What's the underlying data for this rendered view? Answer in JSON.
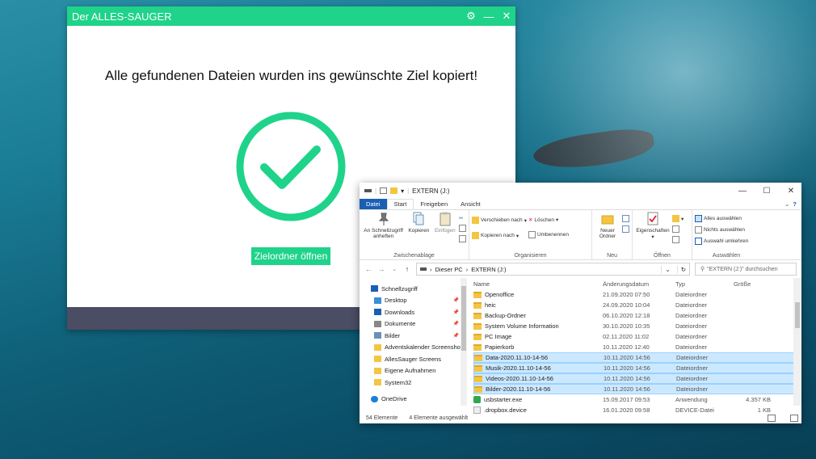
{
  "sauger": {
    "title": "Der ALLES-SAUGER",
    "message": "Alle gefundenen Dateien wurden ins gewünschte Ziel kopiert!",
    "button": "Zielordner öffnen",
    "accent": "#1fd38a"
  },
  "explorer": {
    "title": "EXTERN (J:)",
    "tabs": [
      "Datei",
      "Start",
      "Freigeben",
      "Ansicht"
    ],
    "ribbon": {
      "clipboard": {
        "label": "Zwischenablage",
        "pin": "An Schnellzugriff anheften",
        "copy": "Kopieren",
        "paste": "Einfügen"
      },
      "organize": {
        "label": "Organisieren",
        "move": "Verschieben nach",
        "copy_to": "Kopieren nach",
        "delete": "Löschen",
        "rename": "Umbenennen"
      },
      "new": {
        "label": "Neu",
        "folder": "Neuer Ordner"
      },
      "open": {
        "label": "Öffnen",
        "properties": "Eigenschaften"
      },
      "select": {
        "label": "Auswählen",
        "all": "Alles auswählen",
        "none": "Nichts auswählen",
        "invert": "Auswahl umkehren"
      }
    },
    "address": {
      "pc": "Dieser PC",
      "drive": "EXTERN (J:)",
      "search_placeholder": "\"EXTERN (J:)\" durchsuchen"
    },
    "nav": [
      {
        "label": "Schnellzugriff",
        "icon": "star-icon",
        "pinned": false
      },
      {
        "label": "Desktop",
        "icon": "desktop-icon",
        "pinned": true
      },
      {
        "label": "Downloads",
        "icon": "download-icon",
        "pinned": true
      },
      {
        "label": "Dokumente",
        "icon": "document-icon",
        "pinned": true
      },
      {
        "label": "Bilder",
        "icon": "picture-icon",
        "pinned": true
      },
      {
        "label": "Adventskalender Screensho",
        "icon": "folder-icon",
        "pinned": false
      },
      {
        "label": "AllesSauger Screens",
        "icon": "folder-icon",
        "pinned": false
      },
      {
        "label": "Eigene Aufnahmen",
        "icon": "folder-icon",
        "pinned": false
      },
      {
        "label": "System32",
        "icon": "folder-icon",
        "pinned": false
      },
      {
        "label": "OneDrive",
        "icon": "cloud-icon",
        "pinned": false
      }
    ],
    "pin_glyph": "📌",
    "columns": {
      "name": "Name",
      "date": "Änderungsdatum",
      "type": "Typ",
      "size": "Größe"
    },
    "rows": [
      {
        "name": "Openoffice",
        "date": "21.09.2020 07:50",
        "type": "Dateiordner",
        "size": "",
        "kind": "folder",
        "selected": false
      },
      {
        "name": "heic",
        "date": "24.09.2020 10:04",
        "type": "Dateiordner",
        "size": "",
        "kind": "folder",
        "selected": false
      },
      {
        "name": "Backup-Ordner",
        "date": "06.10.2020 12:18",
        "type": "Dateiordner",
        "size": "",
        "kind": "folder",
        "selected": false
      },
      {
        "name": "System Volume Information",
        "date": "30.10.2020 10:35",
        "type": "Dateiordner",
        "size": "",
        "kind": "folder",
        "selected": false
      },
      {
        "name": "PC Image",
        "date": "02.11.2020 11:02",
        "type": "Dateiordner",
        "size": "",
        "kind": "folder",
        "selected": false
      },
      {
        "name": "Papierkorb",
        "date": "10.11.2020 12:40",
        "type": "Dateiordner",
        "size": "",
        "kind": "folder",
        "selected": false
      },
      {
        "name": "Data-2020.11.10-14-56",
        "date": "10.11.2020 14:56",
        "type": "Dateiordner",
        "size": "",
        "kind": "folder",
        "selected": true
      },
      {
        "name": "Musik-2020.11.10-14-56",
        "date": "10.11.2020 14:56",
        "type": "Dateiordner",
        "size": "",
        "kind": "folder",
        "selected": true
      },
      {
        "name": "Videos-2020.11.10-14-56",
        "date": "10.11.2020 14:56",
        "type": "Dateiordner",
        "size": "",
        "kind": "folder",
        "selected": true
      },
      {
        "name": "Bilder-2020.11.10-14-56",
        "date": "10.11.2020 14:56",
        "type": "Dateiordner",
        "size": "",
        "kind": "folder",
        "selected": true
      },
      {
        "name": "usbstarter.exe",
        "date": "15.09.2017 09:53",
        "type": "Anwendung",
        "size": "4.357 KB",
        "kind": "exe",
        "selected": false
      },
      {
        "name": ".dropbox.device",
        "date": "16.01.2020 09:58",
        "type": "DEVICE-Datei",
        "size": "1 KB",
        "kind": "file",
        "selected": false
      }
    ],
    "status": {
      "count": "54 Elemente",
      "selected": "4 Elemente ausgewählt"
    }
  }
}
